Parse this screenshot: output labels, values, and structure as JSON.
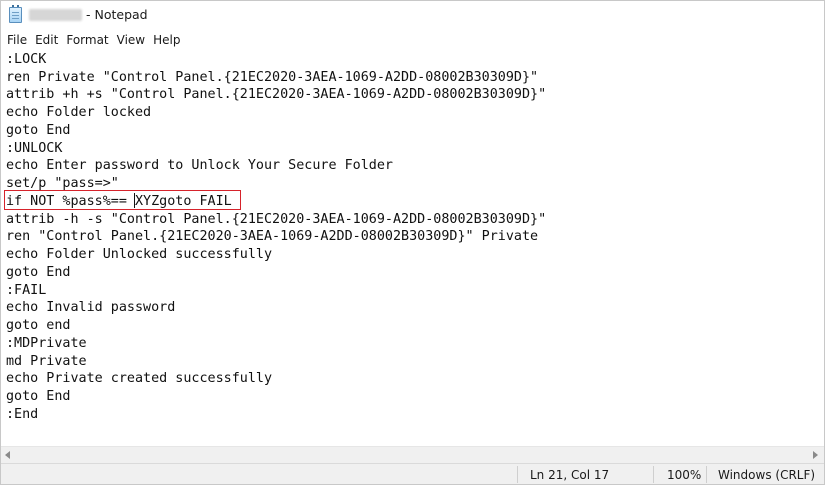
{
  "window": {
    "title": "- Notepad"
  },
  "menu": [
    "File",
    "Edit",
    "Format",
    "View",
    "Help"
  ],
  "editor": {
    "lines": [
      ":LOCK",
      "ren Private \"Control Panel.{21EC2020-3AEA-1069-A2DD-08002B30309D}\"",
      "attrib +h +s \"Control Panel.{21EC2020-3AEA-1069-A2DD-08002B30309D}\"",
      "echo Folder locked",
      "goto End",
      ":UNLOCK",
      "echo Enter password to Unlock Your Secure Folder",
      "set/p \"pass=>\"",
      "if NOT %pass%== XYZgoto FAIL",
      "attrib -h -s \"Control Panel.{21EC2020-3AEA-1069-A2DD-08002B30309D}\"",
      "ren \"Control Panel.{21EC2020-3AEA-1069-A2DD-08002B30309D}\" Private",
      "echo Folder Unlocked successfully",
      "goto End",
      ":FAIL",
      "echo Invalid password",
      "goto end",
      ":MDPrivate",
      "md Private",
      "echo Private created successfully",
      "goto End",
      ":End"
    ],
    "highlight_color": "#d6232b"
  },
  "statusbar": {
    "position": "Ln 21, Col 17",
    "zoom": "100%",
    "line_ending": "Windows (CRLF)"
  },
  "icons": {
    "app": "notepad-icon"
  }
}
